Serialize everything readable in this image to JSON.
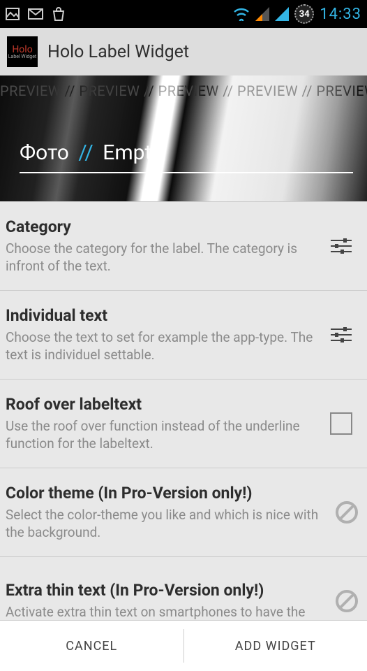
{
  "status": {
    "badge_value": "34",
    "time": "14:33"
  },
  "header": {
    "app_title": "Holo Label Widget",
    "icon_line1": "Holo",
    "icon_line2": "Label Widget"
  },
  "preview": {
    "watermark": "PREVIEW // PREVIEW // PREVIEW // PREVIEW // PREVIEW",
    "category": "Фото",
    "separator": "//",
    "text": "Empty"
  },
  "settings": [
    {
      "title": "Category",
      "desc": "Choose the category for the label. The category is infront of the text.",
      "action": "sliders"
    },
    {
      "title": "Individual text",
      "desc": "Choose the text to set for example the app-type. The text is individuel settable.",
      "action": "sliders"
    },
    {
      "title": "Roof over labeltext",
      "desc": "Use the roof over function instead of the underline function for the labeltext.",
      "action": "checkbox"
    },
    {
      "title": "Color theme (In Pro-Version only!)",
      "desc": "Select the color-theme you like and which is nice with the background.",
      "action": "disabled"
    },
    {
      "title": "Extra thin text (In Pro-Version only!)",
      "desc": "Activate extra thin text on smartphones to have the",
      "action": "disabled"
    }
  ],
  "bottom": {
    "cancel": "CANCEL",
    "add": "ADD WIDGET"
  }
}
